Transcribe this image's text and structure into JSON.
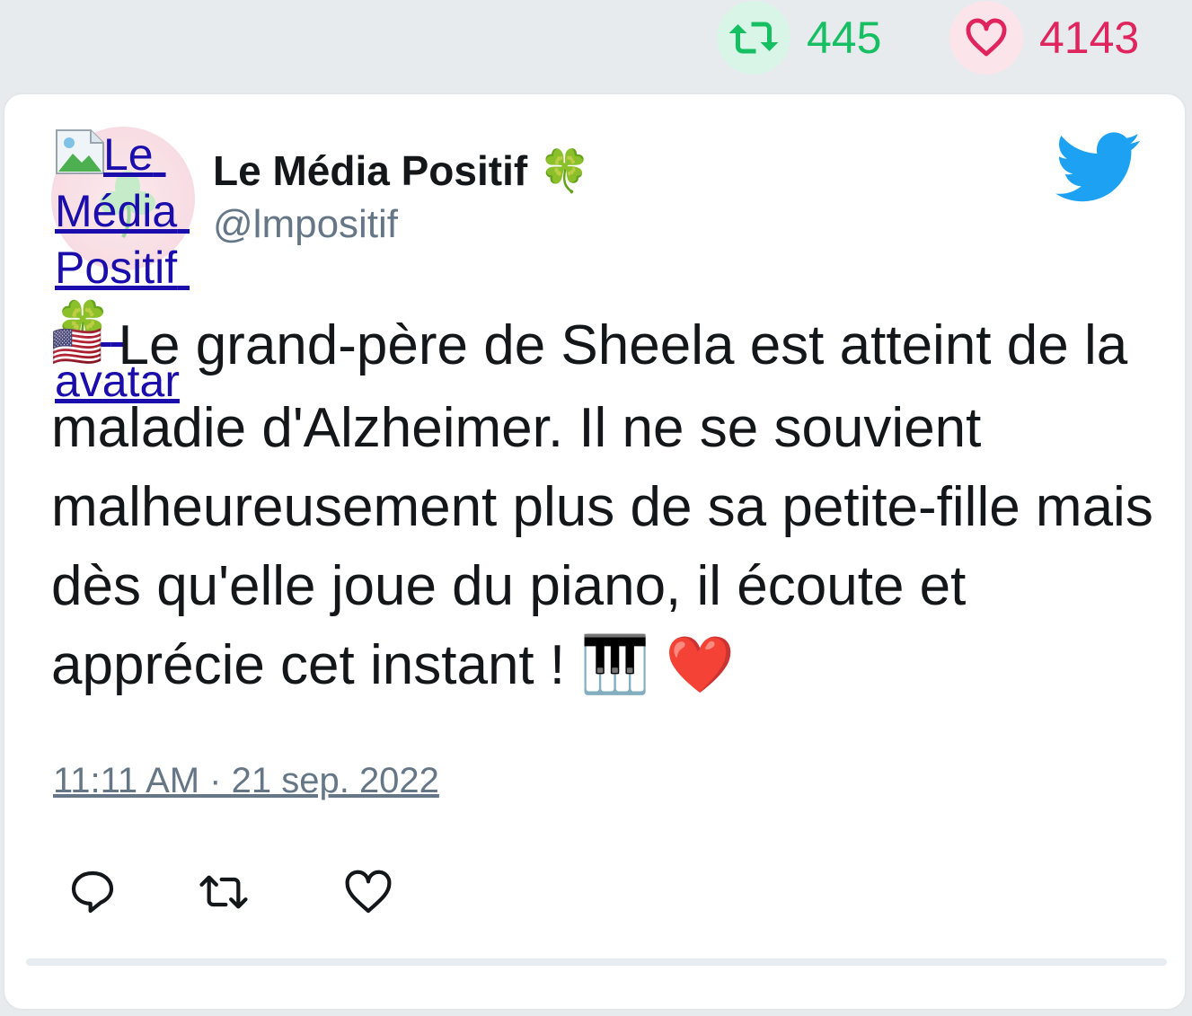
{
  "stats": {
    "retweet_count": "445",
    "like_count": "4143",
    "retweet_icon": "retweet-icon",
    "like_icon": "heart-icon"
  },
  "tweet": {
    "avatar_alt": "Le Média Positif 🍀 avatar",
    "author_name": "Le Média Positif 🍀",
    "author_handle": "@lmpositif",
    "flag": "🇺🇸",
    "text": " Le grand-père de Sheela est atteint de la maladie d'Alzheimer. Il ne se souvient malheureusement plus de sa petite-fille mais dès qu'elle joue du piano, il écoute et apprécie cet instant ! 🎹 ❤️",
    "timestamp": "11:11 AM · 21 sep. 2022",
    "platform_icon": "twitter-bird-icon"
  },
  "actions": {
    "reply_icon": "reply-icon",
    "retweet_icon": "retweet-icon",
    "like_icon": "heart-icon"
  },
  "colors": {
    "retweet_green": "#17bf63",
    "like_red": "#e0245e",
    "twitter_blue": "#1da1f2",
    "text_primary": "#14171a",
    "text_secondary": "#657786"
  }
}
